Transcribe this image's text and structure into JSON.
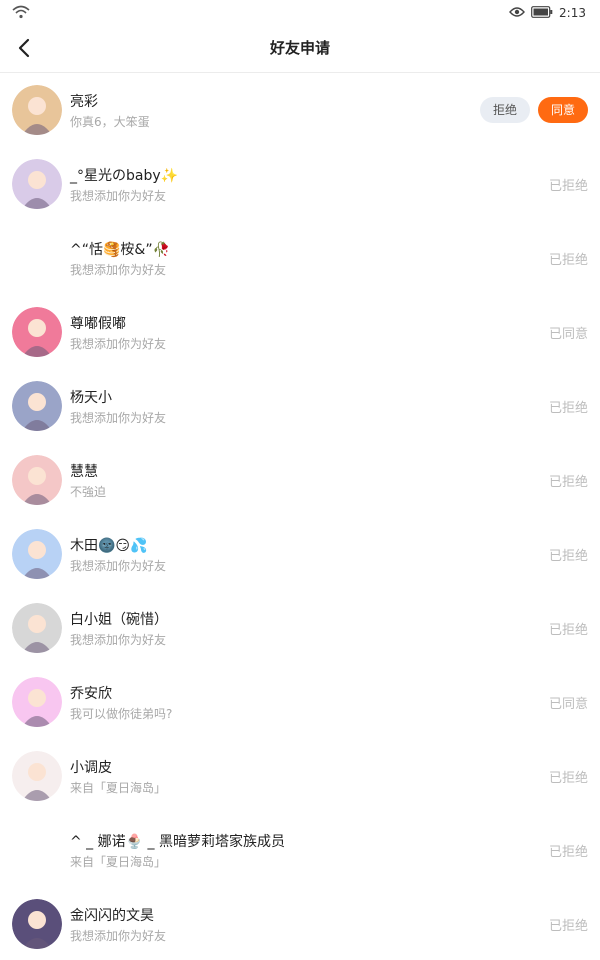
{
  "status_bar": {
    "time": "2:13",
    "icons": [
      "wifi-icon",
      "eye-icon",
      "battery-icon"
    ]
  },
  "nav": {
    "title": "好友申请",
    "back_icon": "back-arrow-icon"
  },
  "colors": {
    "accent": "#ff6a12",
    "reject_bg": "#e9edf3",
    "muted_text": "#a8a8a8",
    "status_text": "#bdbdbd"
  },
  "requests": [
    {
      "name": "亮彩",
      "message": "你真6，大笨蛋",
      "status": "",
      "reject_label": "拒绝",
      "accept_label": "同意",
      "avatar_color": "#e8c59a"
    },
    {
      "name": "_°星光のbaby✨",
      "message": "我想添加你为好友",
      "status": "已拒绝",
      "avatar_color": "#d9cbe8"
    },
    {
      "name": "^“恬🥞桉&”🥀",
      "message": "我想添加你为好友",
      "status": "已拒绝",
      "avatar_color": "#ffffff"
    },
    {
      "name": "尊嘟假嘟",
      "message": "我想添加你为好友",
      "status": "已同意",
      "avatar_color": "#f07a9a"
    },
    {
      "name": "杨天小",
      "message": "我想添加你为好友",
      "status": "已拒绝",
      "avatar_color": "#9aa4c8"
    },
    {
      "name": "慧慧",
      "message": "不強迫",
      "status": "已拒绝",
      "avatar_color": "#f4c7c7"
    },
    {
      "name": "木田🌚😏💦",
      "message": "我想添加你为好友",
      "status": "已拒绝",
      "avatar_color": "#b8d2f5"
    },
    {
      "name": "白小姐（碗惜）",
      "message": "我想添加你为好友",
      "status": "已拒绝",
      "avatar_color": "#d7d7d7"
    },
    {
      "name": "乔安欣",
      "message": "我可以做你徒弟吗?",
      "status": "已同意",
      "avatar_color": "#f8c6f0"
    },
    {
      "name": "小调皮",
      "message": "来自「夏日海岛」",
      "status": "已拒绝",
      "avatar_color": "#f6eeee"
    },
    {
      "name": "^ _ 娜诺🍨 _ 黑暗萝莉塔家族成员",
      "message": "来自「夏日海岛」",
      "status": "已拒绝",
      "avatar_color": "#ffffff"
    },
    {
      "name": "金闪闪的文昊",
      "message": "我想添加你为好友",
      "status": "已拒绝",
      "avatar_color": "#5a4f7a"
    }
  ]
}
